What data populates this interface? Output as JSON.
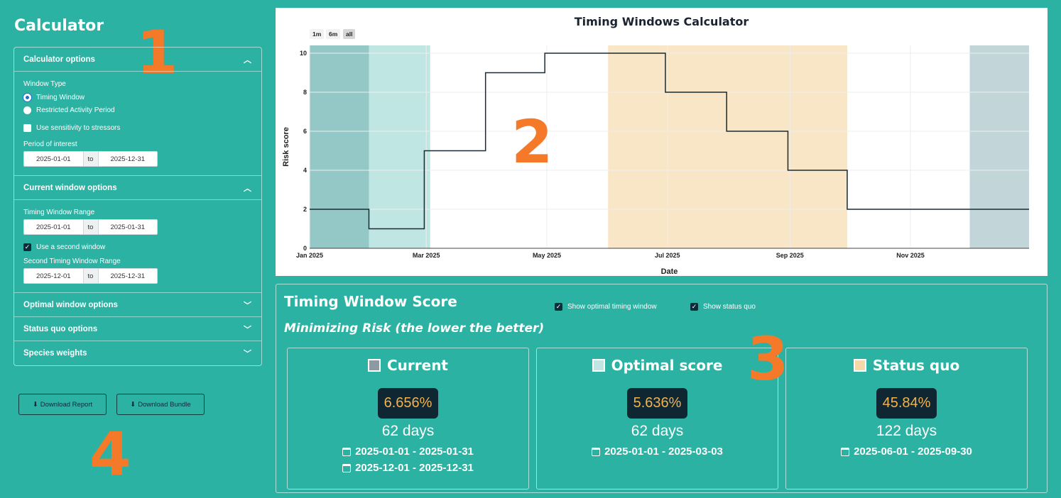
{
  "sidebar": {
    "title": "Calculator",
    "sections": {
      "calc_options": {
        "header": "Calculator options",
        "window_type_label": "Window Type",
        "radio_timing": "Timing Window",
        "radio_restricted": "Restricted Activity Period",
        "sensitivity_label": "Use sensitivity to stressors",
        "period_label": "Period of interest",
        "period_start": "2025-01-01",
        "period_to": "to",
        "period_end": "2025-12-31"
      },
      "current_window": {
        "header": "Current window options",
        "range_label": "Timing Window Range",
        "range_start": "2025-01-01",
        "range_to": "to",
        "range_end": "2025-01-31",
        "second_window_label": "Use a second window",
        "second_range_label": "Second Timing Window Range",
        "second_start": "2025-12-01",
        "second_to": "to",
        "second_end": "2025-12-31"
      },
      "optimal": {
        "header": "Optimal window options"
      },
      "status_quo": {
        "header": "Status quo options"
      },
      "species": {
        "header": "Species weights"
      }
    },
    "download_report": "Download Report",
    "download_bundle": "Download Bundle"
  },
  "markers": {
    "one": "1",
    "two": "2",
    "three": "3",
    "four": "4"
  },
  "chart_data": {
    "type": "line",
    "title": "Timing Windows Calculator",
    "xlabel": "Date",
    "ylabel": "Risk score",
    "range_buttons": [
      "1m",
      "6m",
      "all"
    ],
    "x_ticks": [
      "Jan 2025",
      "Mar 2025",
      "May 2025",
      "Jul 2025",
      "Sep 2025",
      "Nov 2025"
    ],
    "y_ticks": [
      "0",
      "2",
      "4",
      "6",
      "8",
      "10"
    ],
    "ylim": [
      0,
      10.4
    ],
    "xlim": [
      "2025-01-01",
      "2025-12-31"
    ],
    "series": [
      {
        "line_shape": "step",
        "x": [
          "2025-01-01",
          "2025-01-31",
          "2025-02-28",
          "2025-03-31",
          "2025-04-30",
          "2025-06-30",
          "2025-07-31",
          "2025-08-31",
          "2025-09-30",
          "2025-12-31"
        ],
        "y": [
          2,
          1,
          5,
          9,
          10,
          8,
          6,
          4,
          2,
          2
        ]
      }
    ],
    "shaded_regions": [
      {
        "start": "2025-01-01",
        "end": "2025-01-31",
        "color": "#93c8c6"
      },
      {
        "start": "2025-01-31",
        "end": "2025-03-03",
        "color": "#c0e6e3"
      },
      {
        "start": "2025-06-01",
        "end": "2025-09-30",
        "color": "#f8e6c6"
      },
      {
        "start": "2025-12-01",
        "end": "2025-12-31",
        "color": "#c2d6da"
      }
    ]
  },
  "score": {
    "title": "Timing Window Score",
    "subtitle": "Minimizing Risk (the lower the better)",
    "toggle_optimal": "Show optimal timing window",
    "toggle_status_quo": "Show status quo",
    "cards": [
      {
        "title": "Current",
        "swatch_color": "#8e9aa3",
        "pct": "6.656%",
        "days": "62 days",
        "ranges": [
          "2025-01-01 - 2025-01-31",
          "2025-12-01 - 2025-12-31"
        ]
      },
      {
        "title": "Optimal score",
        "swatch_color": "#bfe6e2",
        "pct": "5.636%",
        "days": "62 days",
        "ranges": [
          "2025-01-01 - 2025-03-03"
        ]
      },
      {
        "title": "Status quo",
        "swatch_color": "#f5d9a8",
        "pct": "45.84%",
        "days": "122 days",
        "ranges": [
          "2025-06-01 - 2025-09-30"
        ]
      }
    ]
  }
}
